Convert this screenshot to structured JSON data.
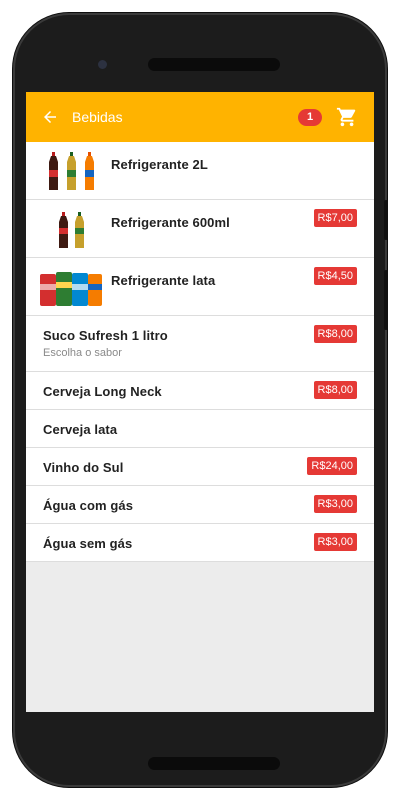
{
  "appbar": {
    "title": "Bebidas",
    "cart_count": "1",
    "back_icon": "arrow-left-icon",
    "cart_icon": "shopping-cart-icon"
  },
  "colors": {
    "accent": "#ffb300",
    "price_badge": "#e53935",
    "background": "#ececec"
  },
  "items": [
    {
      "name": "Refrigerante 2L",
      "price": "",
      "subtitle": "",
      "image": "soda-2l-bottles-icon"
    },
    {
      "name": "Refrigerante 600ml",
      "price": "R$7,00",
      "subtitle": "",
      "image": "soda-600ml-bottles-icon"
    },
    {
      "name": "Refrigerante lata",
      "price": "R$4,50",
      "subtitle": "",
      "image": "soda-cans-icon"
    },
    {
      "name": "Suco Sufresh 1 litro",
      "price": "R$8,00",
      "subtitle": "Escolha o sabor"
    },
    {
      "name": "Cerveja Long Neck",
      "price": "R$8,00",
      "subtitle": ""
    },
    {
      "name": "Cerveja lata",
      "price": "",
      "subtitle": ""
    },
    {
      "name": "Vinho do Sul",
      "price": "R$24,00",
      "subtitle": ""
    },
    {
      "name": "Água com gás",
      "price": "R$3,00",
      "subtitle": ""
    },
    {
      "name": "Água sem gás",
      "price": "R$3,00",
      "subtitle": ""
    }
  ]
}
